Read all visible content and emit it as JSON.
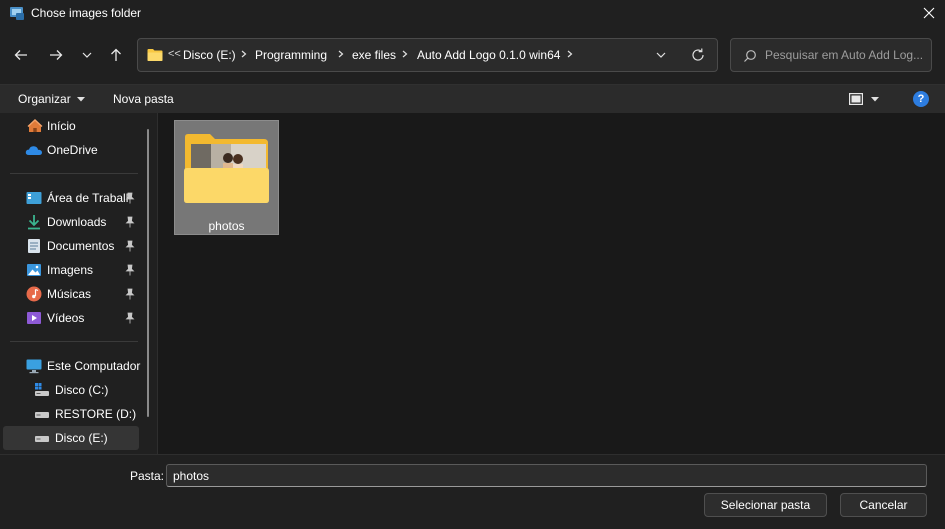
{
  "window": {
    "title": "Chose images folder"
  },
  "address": {
    "overflow_label": "<<",
    "crumbs": [
      "Disco (E:)",
      "Programming",
      "exe files",
      "Auto Add Logo 0.1.0 win64"
    ]
  },
  "search": {
    "placeholder": "Pesquisar em Auto Add Log..."
  },
  "toolbar": {
    "organize_label": "Organizar",
    "new_folder_label": "Nova pasta",
    "help_label": "?"
  },
  "sidebar": {
    "items": [
      {
        "label": "Início",
        "icon": "home-icon"
      },
      {
        "label": "OneDrive",
        "icon": "cloud-icon"
      },
      {
        "label": "Área de Traball",
        "icon": "desktop-icon",
        "pinned": true
      },
      {
        "label": "Downloads",
        "icon": "download-icon",
        "pinned": true
      },
      {
        "label": "Documentos",
        "icon": "document-icon",
        "pinned": true
      },
      {
        "label": "Imagens",
        "icon": "image-icon",
        "pinned": true
      },
      {
        "label": "Músicas",
        "icon": "music-icon",
        "pinned": true
      },
      {
        "label": "Vídeos",
        "icon": "video-icon",
        "pinned": true
      },
      {
        "label": "Este Computador",
        "icon": "computer-icon"
      },
      {
        "label": "Disco (C:)",
        "icon": "drive-icon"
      },
      {
        "label": "RESTORE (D:)",
        "icon": "drive-icon"
      },
      {
        "label": "Disco (E:)",
        "icon": "drive-icon",
        "selected": true
      }
    ]
  },
  "content": {
    "items": [
      {
        "name": "photos",
        "type": "folder",
        "selected": true
      }
    ]
  },
  "footer": {
    "folder_label": "Pasta:",
    "folder_value": "photos",
    "select_button": "Selecionar pasta",
    "cancel_button": "Cancelar"
  },
  "colors": {
    "background": "#202020",
    "content_background": "#191919",
    "folder_yellow": "#f8c842",
    "accent_blue": "#2d7de0"
  }
}
